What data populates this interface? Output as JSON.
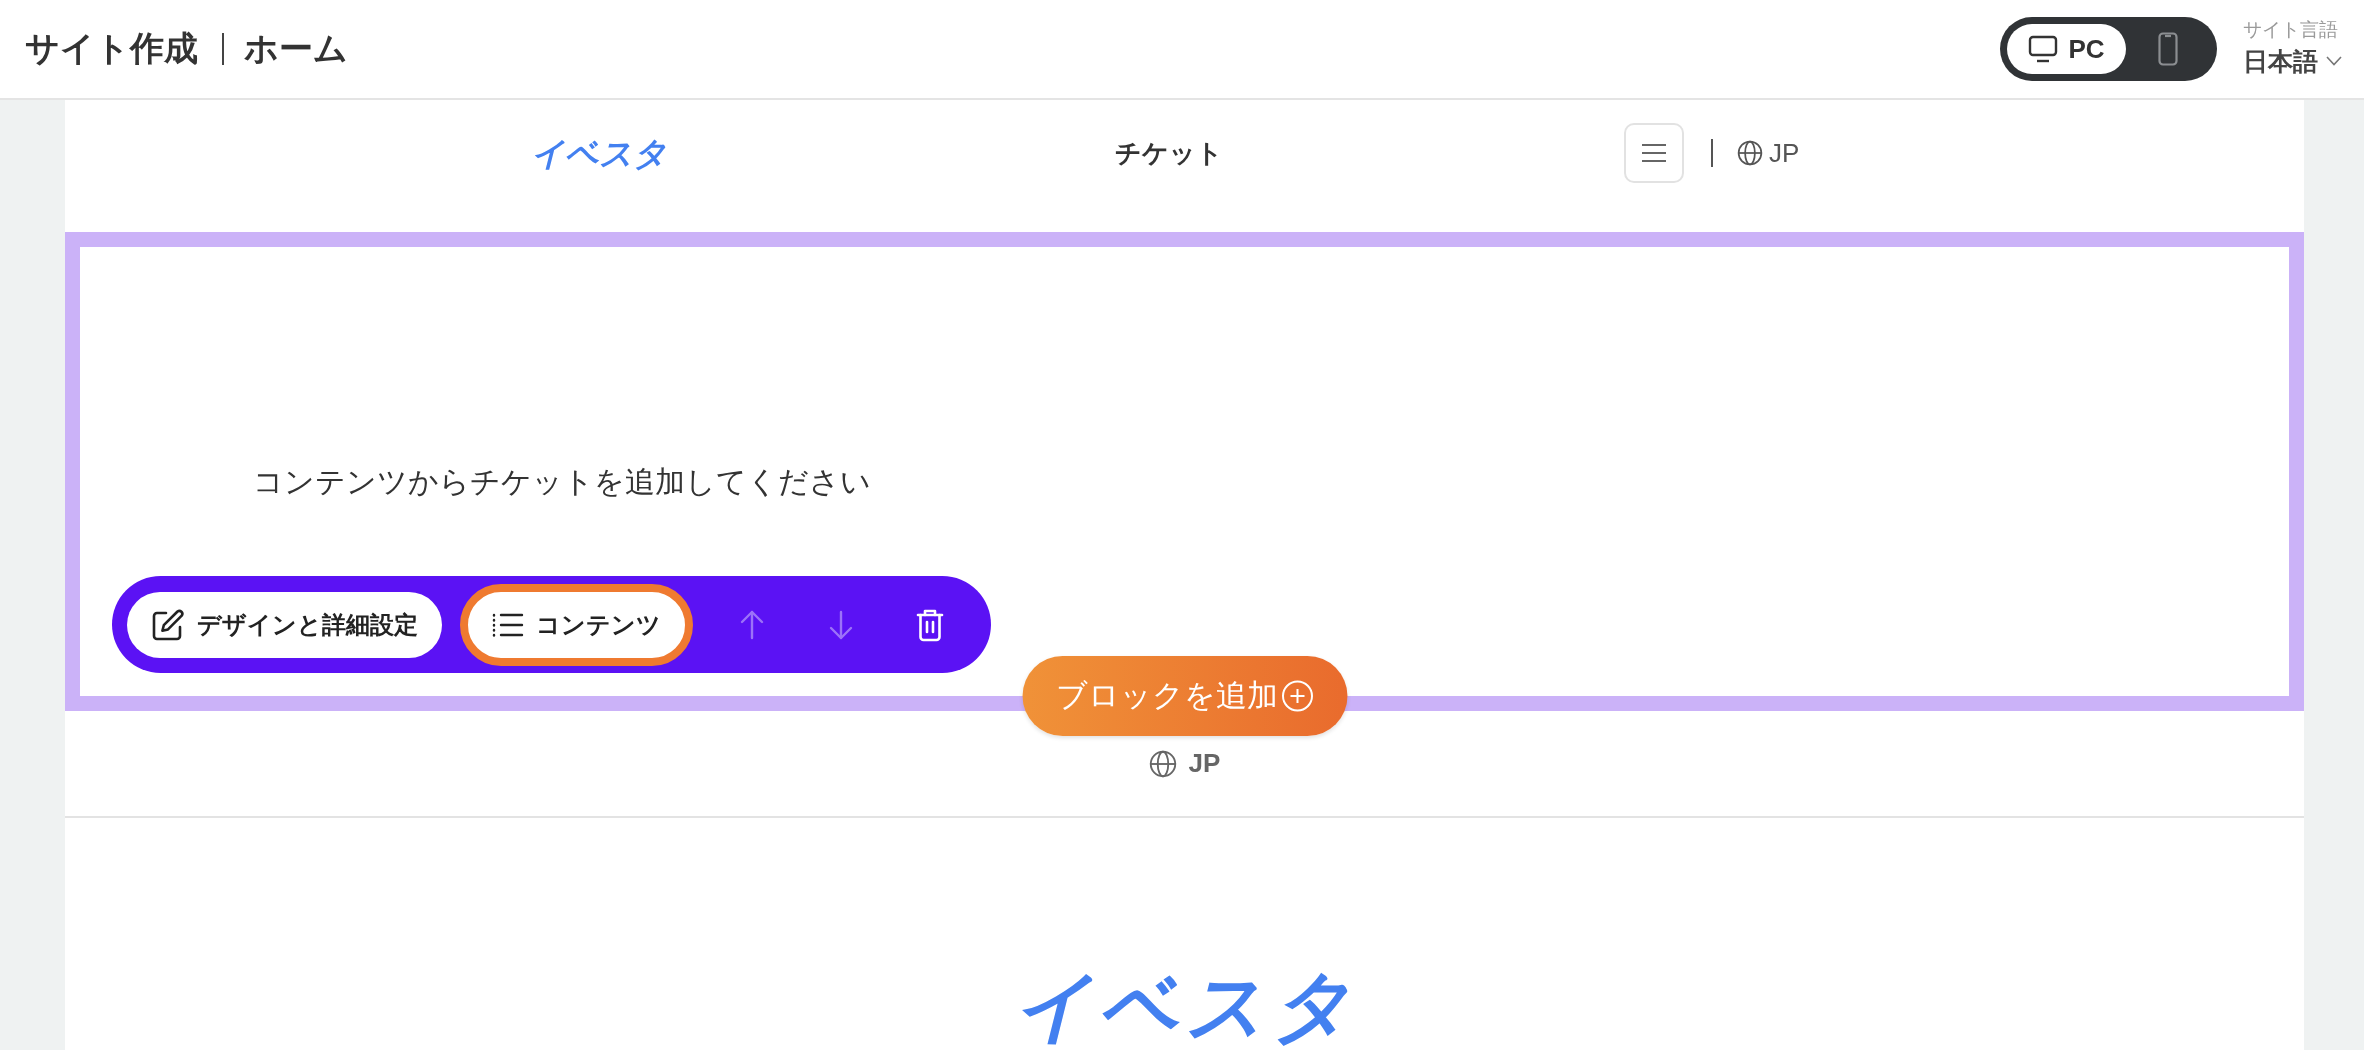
{
  "header": {
    "title": "サイト作成",
    "page": "ホーム",
    "device_toggle": [
      {
        "kind": "desktop",
        "label": "PC",
        "selected": true
      },
      {
        "kind": "mobile",
        "selected": false
      }
    ],
    "site_language": {
      "label": "サイト言語",
      "value": "日本語"
    }
  },
  "site_header": {
    "logo": "イベスタ",
    "nav_item": "チケット",
    "language": "JP"
  },
  "block": {
    "selected": true,
    "message": "コンテンツからチケットを追加してください",
    "toolbar": [
      {
        "kind": "edit",
        "label": "デザインと詳細設定",
        "highlighted": false,
        "disabled": false
      },
      {
        "kind": "list",
        "label": "コンテンツ",
        "highlighted": true,
        "disabled": false
      },
      {
        "kind": "up",
        "highlighted": false,
        "disabled": true
      },
      {
        "kind": "down",
        "highlighted": false,
        "disabled": true
      },
      {
        "kind": "delete",
        "highlighted": false,
        "disabled": false
      }
    ]
  },
  "add_block_button": "ブロックを追加",
  "footer_language": "JP",
  "next_section": {
    "logo": "イベスタ"
  }
}
